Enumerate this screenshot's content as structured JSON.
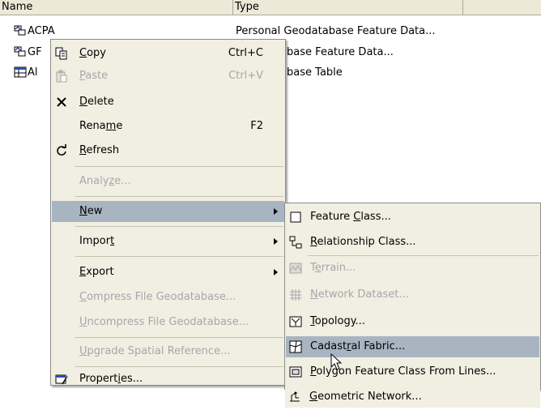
{
  "listview": {
    "columns": [
      "Name",
      "Type",
      ""
    ],
    "rows": [
      {
        "name": "ACPA",
        "type": "Personal Geodatabase Feature Data...",
        "icon": "feature-dataset-icon"
      },
      {
        "name": "GF",
        "type": "l Geodatabase Feature Data...",
        "icon": "feature-dataset-icon"
      },
      {
        "name": "Al",
        "type": "l Geodatabase Table",
        "icon": "table-icon"
      }
    ]
  },
  "context_menu": {
    "copy": {
      "label": "Copy",
      "mnemonic": "C",
      "rest": "opy",
      "shortcut": "Ctrl+C",
      "icon": "copy-icon"
    },
    "paste": {
      "label": "Paste",
      "mnemonic": "P",
      "rest": "aste",
      "shortcut": "Ctrl+V",
      "icon": "paste-icon"
    },
    "delete": {
      "label": "Delete",
      "mnemonic": "D",
      "rest": "elete",
      "icon": "delete-x-icon"
    },
    "rename": {
      "pre": "Rena",
      "mnemonic": "m",
      "rest": "e",
      "label": "Rename",
      "shortcut": "F2"
    },
    "refresh": {
      "label": "Refresh",
      "mnemonic": "R",
      "rest": "efresh",
      "icon": "refresh-icon"
    },
    "analyze": {
      "pre": "Analy",
      "mnemonic": "z",
      "rest": "e...",
      "label": "Analyze..."
    },
    "new": {
      "label": "New",
      "mnemonic": "N",
      "rest": "ew"
    },
    "import": {
      "pre": "Impor",
      "mnemonic": "t",
      "rest": "",
      "label": "Import"
    },
    "export": {
      "label": "Export",
      "mnemonic": "E",
      "rest": "xport"
    },
    "compress": {
      "label": "Compress File Geodatabase...",
      "mnemonic": "C",
      "rest": "ompress File Geodatabase..."
    },
    "uncompress": {
      "label": "Uncompress File Geodatabase...",
      "mnemonic": "U",
      "rest": "ncompress File Geodatabase..."
    },
    "upgrade": {
      "label": "Upgrade Spatial Reference...",
      "mnemonic": "U",
      "rest": "pgrade Spatial Reference..."
    },
    "properties": {
      "pre": "Propert",
      "mnemonic": "i",
      "rest": "es...",
      "label": "Properties...",
      "icon": "properties-icon"
    }
  },
  "submenu_new": {
    "feature_class": {
      "pre": "Feature ",
      "mnemonic": "C",
      "rest": "lass...",
      "label": "Feature Class...",
      "icon": "feature-class-icon"
    },
    "relationship_class": {
      "label": "Relationship Class...",
      "mnemonic": "R",
      "rest": "elationship Class...",
      "icon": "relationship-class-icon"
    },
    "terrain": {
      "pre": "T",
      "mnemonic": "e",
      "rest": "rrain...",
      "label": "Terrain...",
      "icon": "terrain-icon"
    },
    "network_dataset": {
      "label": "Network Dataset...",
      "mnemonic": "N",
      "rest": "etwork Dataset...",
      "icon": "network-dataset-icon"
    },
    "topology": {
      "label": "Topology...",
      "mnemonic": "T",
      "rest": "opology...",
      "icon": "topology-icon"
    },
    "cadastral_fabric": {
      "pre": "Cadast",
      "mnemonic": "r",
      "rest": "al Fabric...",
      "label": "Cadastral Fabric...",
      "icon": "cadastral-fabric-icon"
    },
    "polygon_from_lines": {
      "label": "Polygon Feature Class From Lines...",
      "mnemonic": "P",
      "rest": "olygon Feature Class From Lines...",
      "icon": "polygon-feature-class-icon"
    },
    "geometric_network": {
      "label": "Geometric Network...",
      "mnemonic": "G",
      "rest": "eometric Network...",
      "icon": "geometric-network-icon"
    }
  },
  "colors": {
    "menu_bg": "#f1efe2",
    "highlight": "#a8b4c2",
    "disabled_text": "#a7a6aa",
    "header_bg": "#ece9d8"
  }
}
